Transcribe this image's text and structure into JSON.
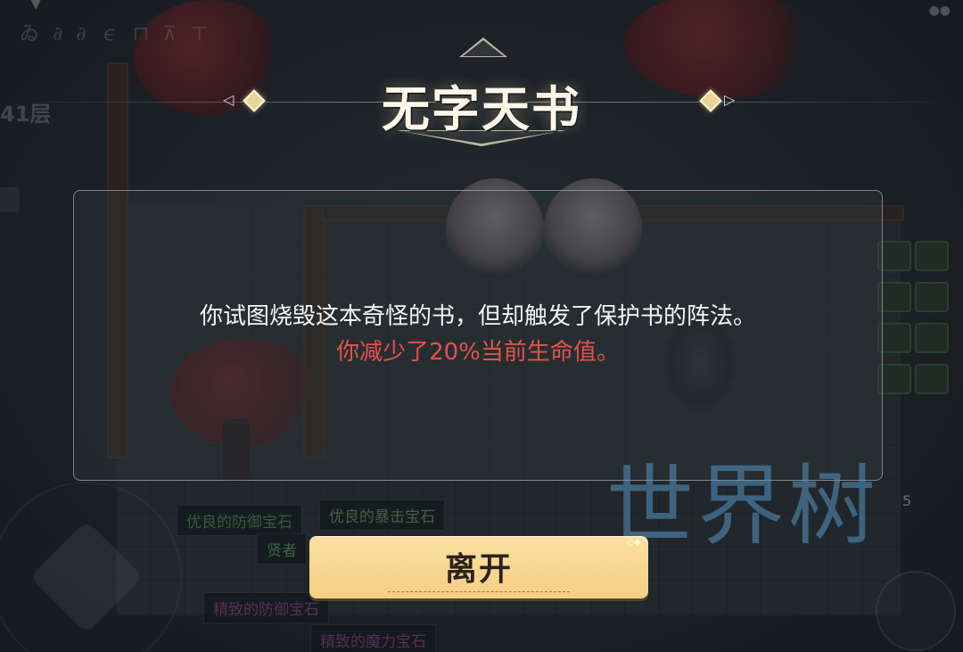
{
  "hud": {
    "top_left_runes": "ゐ ∂ ∂ ∊ ⊓ ⊼ ⊤",
    "floor_label": "41层",
    "slot_count": "5"
  },
  "loot_labels": {
    "item1": "优良的防御宝石",
    "item2": "优良的暴击宝石",
    "item3": "贤者",
    "item4": "精致的防御宝石",
    "item5": "精致的魔力宝石"
  },
  "dialog": {
    "title": "无字天书",
    "message": "你试图烧毁这本奇怪的书，但却触发了保护书的阵法。",
    "effect": "你减少了20%当前生命值。",
    "leave_button": "离开"
  },
  "watermark": "世界树",
  "colors": {
    "effect_text": "#e5524a",
    "button_bg": "#f7d48d",
    "watermark": "#5896c4"
  }
}
